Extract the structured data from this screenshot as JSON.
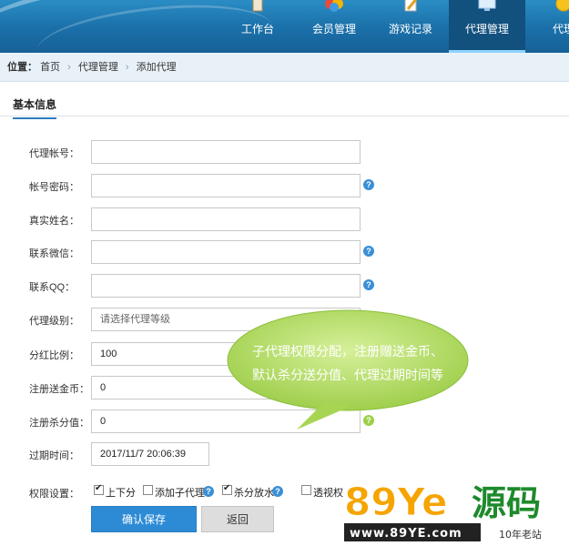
{
  "nav": {
    "items": [
      {
        "label": "工作台",
        "icon": "clipboard-icon"
      },
      {
        "label": "会员管理",
        "icon": "members-icon"
      },
      {
        "label": "游戏记录",
        "icon": "pen-icon"
      },
      {
        "label": "代理管理",
        "icon": "monitor-icon",
        "active": true
      },
      {
        "label": "代理",
        "icon": "coin-icon"
      }
    ]
  },
  "breadcrumb": {
    "prefix": "位置：",
    "items": [
      "首页",
      "代理管理",
      "添加代理"
    ]
  },
  "section_title": "基本信息",
  "form": {
    "account_label": "代理帐号：",
    "account_value": "",
    "password_label": "帐号密码：",
    "password_value": "",
    "realname_label": "真实姓名：",
    "realname_value": "",
    "wechat_label": "联系微信：",
    "wechat_value": "",
    "qq_label": "联系QQ：",
    "qq_value": "",
    "level_label": "代理级别：",
    "level_placeholder": "请选择代理等级",
    "share_label": "分红比例：",
    "share_value": "100",
    "gift_label": "注册送金币：",
    "gift_value": "0",
    "kill_label": "注册杀分值：",
    "kill_value": "0",
    "expire_label": "过期时间：",
    "expire_value": "2017/11/7 20:06:39"
  },
  "permissions": {
    "label": "权限设置：",
    "items": [
      {
        "label": "上下分",
        "checked": true
      },
      {
        "label": "添加子代理",
        "checked": false
      },
      {
        "label": "杀分放水",
        "checked": true
      },
      {
        "label": "透视权",
        "checked": false
      }
    ]
  },
  "buttons": {
    "save": "确认保存",
    "back": "返回"
  },
  "callout": {
    "line1": "子代理权限分配，注册赠送金币、",
    "line2": "默认杀分送分值、代理过期时间等",
    "color": "#b9e36c"
  },
  "watermark": {
    "big": "89Ye源码",
    "url": "www.89YE.com",
    "tag": "10年老站"
  },
  "colors": {
    "nav_blue": "#1a6fa8",
    "accent": "#2d8bd6",
    "help_blue": "#3a8fd6"
  }
}
